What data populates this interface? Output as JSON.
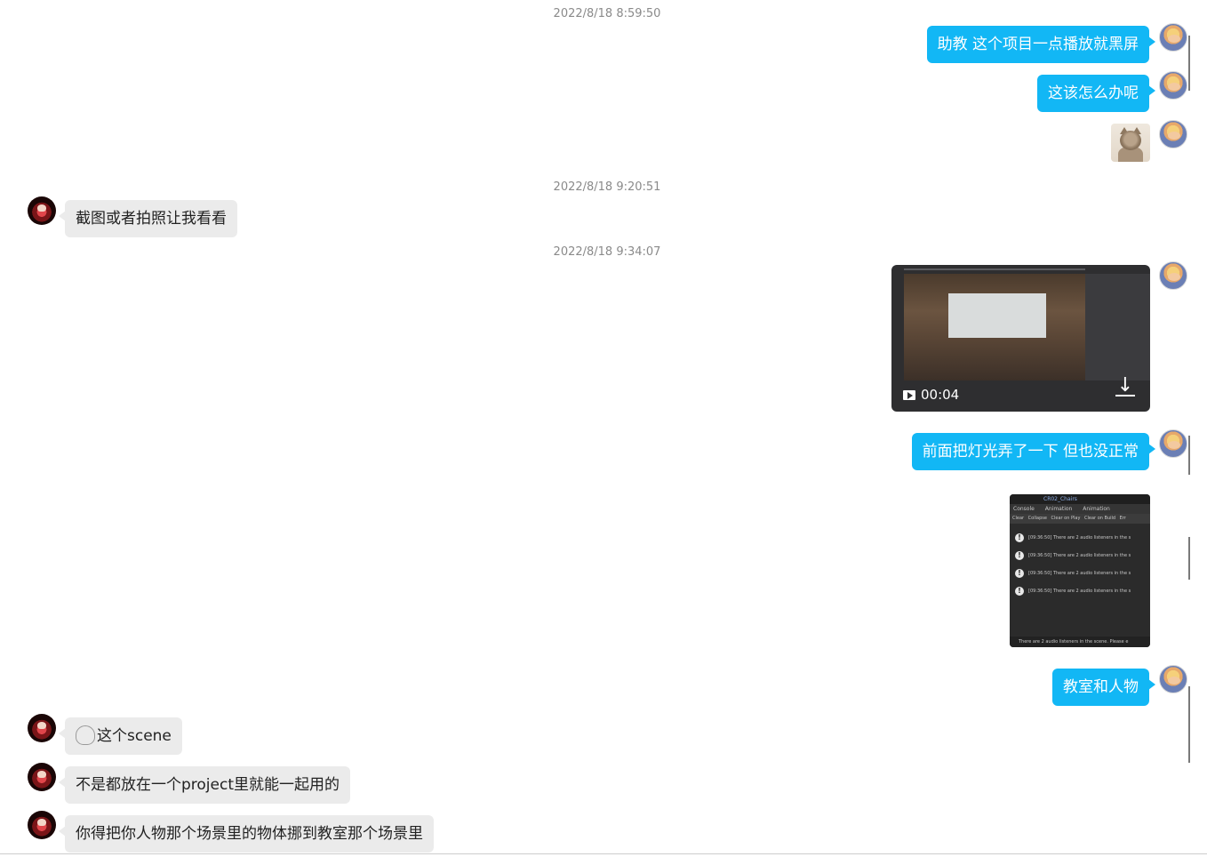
{
  "timestamps": {
    "t1": "2022/8/18 8:59:50",
    "t2": "2022/8/18 9:20:51",
    "t3": "2022/8/18 9:34:07"
  },
  "messages": {
    "m1": "助教 这个项目一点播放就黑屏",
    "m2": "这该怎么办呢",
    "m3": "截图或者拍照让我看看",
    "m4_duration": "00:04",
    "m5": "前面把灯光弄了一下 但也没正常",
    "m6": "教室和人物",
    "m7": "这个scene",
    "m8": "不是都放在一个project里就能一起用的",
    "m9": "你得把你人物那个场景里的物体挪到教室那个场景里"
  },
  "screenshot": {
    "header": "CR02_Chairs",
    "tabs": [
      "Console",
      "Animation",
      "Animation"
    ],
    "tools": [
      "Clear",
      "Collapse",
      "Clear on Play",
      "Clear on Build",
      "Err"
    ],
    "log_rows": [
      "[09:36:50] There are 2 audio listeners in the s",
      "[09:36:50] There are 2 audio listeners in the s",
      "[09:36:50] There are 2 audio listeners in the s",
      "[09:36:50] There are 2 audio listeners in the s"
    ],
    "footer": "There are 2 audio listeners in the scene. Please e"
  },
  "colors": {
    "outgoing_bubble": "#12b7f5",
    "incoming_bubble": "#ebebeb",
    "timestamp": "#8a8a8a"
  },
  "icons": {
    "video_play": "play-icon",
    "video_download": "download-icon",
    "sticker": "ghost-emoji-icon"
  }
}
